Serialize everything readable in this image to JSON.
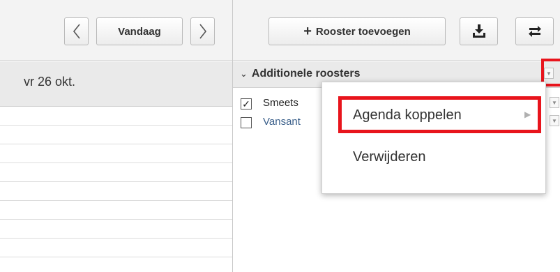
{
  "toolbar": {
    "prev_icon": "<",
    "today_label": "Vandaag",
    "next_icon": ">",
    "add_label": "Rooster toevoegen",
    "add_icon": "+",
    "download_icon": "download-icon",
    "sync_icon": "sync-icon"
  },
  "calendar": {
    "day_header": "vr 26 okt."
  },
  "panel": {
    "title": "Additionele roosters",
    "rosters": [
      {
        "name": "Smeets",
        "checked": true
      },
      {
        "name": "Vansant",
        "checked": false
      }
    ]
  },
  "context_menu": {
    "items": [
      {
        "label": "Agenda koppelen",
        "has_submenu": true
      },
      {
        "label": "Verwijderen",
        "has_submenu": false
      }
    ]
  },
  "colors": {
    "highlight": "#e8141c",
    "toolbar_bg": "#f3f3f3",
    "header_bg": "#eaeaea"
  }
}
